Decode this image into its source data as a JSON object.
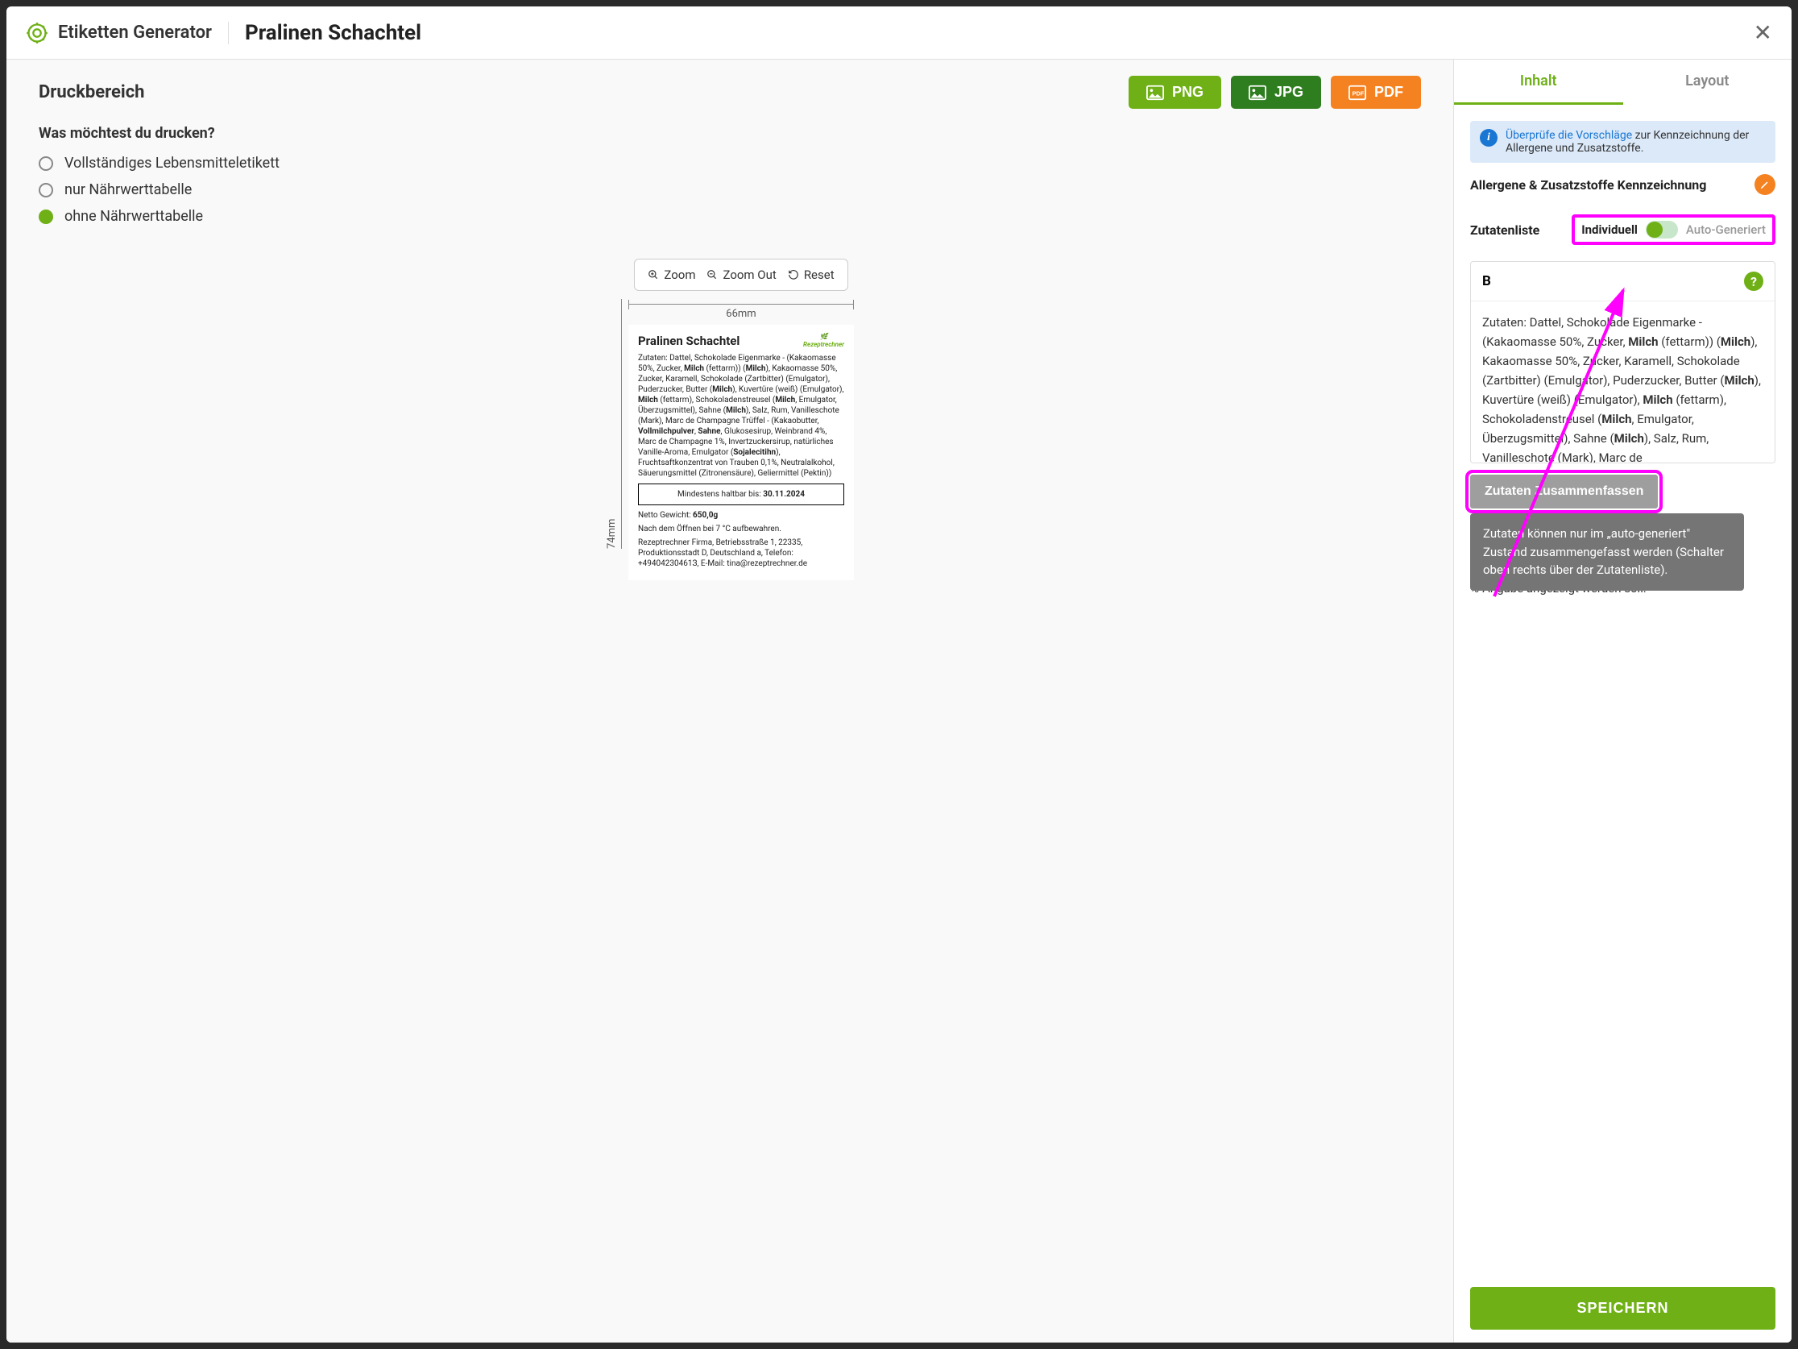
{
  "header": {
    "app_title": "Etiketten Generator",
    "recipe_title": "Pralinen Schachtel"
  },
  "left": {
    "heading": "Druckbereich",
    "export": {
      "png": "PNG",
      "jpg": "JPG",
      "pdf": "PDF"
    },
    "question": "Was möchtest du drucken?",
    "options": {
      "full": "Vollständiges Lebensmitteletikett",
      "only_nutri": "nur Nährwerttabelle",
      "no_nutri": "ohne Nährwerttabelle"
    },
    "zoom": {
      "in": "Zoom",
      "out": "Zoom Out",
      "reset": "Reset"
    },
    "ruler": {
      "width": "66mm",
      "height": "74mm"
    },
    "label": {
      "title": "Pralinen Schachtel",
      "brand": "Rezeptrechner",
      "ingredients_html": "Zutaten: Dattel, Schokolade Eigenmarke - (Kakaomasse 50%, Zucker, <b>Milch</b> (fettarm)) (<b>Milch</b>), Kakaomasse 50%, Zucker, Karamell, Schokolade (Zartbitter) (Emulgator), Puderzucker, Butter (<b>Milch</b>), Kuvertüre (weiß) (Emulgator), <b>Milch</b> (fettarm), Schokoladenstreusel (<b>Milch</b>, Emulgator, Überzugsmittel), Sahne (<b>Milch</b>), Salz, Rum, Vanilleschote (Mark), Marc de Champagne Trüffel - (Kakaobutter, <b>Vollmilchpulver</b>, <b>Sahne</b>, Glukosesirup, Weinbrand 4%, Marc de Champagne 1%, Invertzuckersirup, natürliches Vanille-Aroma, Emulgator (<b>Sojalecitihn</b>), Fruchtsaftkonzentrat von Trauben 0,1%, Neutralalkohol, Säuerungsmittel (Zitronensäure), Geliermittel (Pektin))",
      "mhd_label": "Mindestens haltbar bis: ",
      "mhd_date": "30.11.2024",
      "weight_label": "Netto Gewicht: ",
      "weight_value": "650,0g",
      "storage": "Nach dem Öffnen bei 7 °C aufbewahren.",
      "company": "Rezeptrechner Firma, Betriebsstraße 1, 22335, Produktionsstadt D, Deutschland a, Telefon: +49404230461З, E-Mail: tina@rezeptrechner.de"
    }
  },
  "right": {
    "tabs": {
      "content": "Inhalt",
      "layout": "Layout"
    },
    "info": {
      "link": "Überprüfe die Vorschläge",
      "text": " zur Kennzeichnung der Allergene und Zusatzstoffe."
    },
    "allergen_heading": "Allergene & Zusatzstoffe Kennzeichnung",
    "list_label": "Zutatenliste",
    "toggle": {
      "individual": "Individuell",
      "auto": "Auto-Generiert"
    },
    "ing_box": {
      "marker": "B",
      "text_html": "Zutaten: Dattel, Schokolade Eigenmarke - (Kakaomasse 50%, Zucker, <b>Milch</b> (fettarm)) (<b>Milch</b>), Kakaomasse 50%, Zucker, Karamell, Schokolade (Zartbitter) (Emulgator), Puderzucker, Butter (<b>Milch</b>), Kuvertüre (weiß) (Emulgator), <b>Milch</b> (fettarm), Schokoladenstreusel (<b>Milch</b>, Emulgator, Überzugsmittel), Sahne (<b>Milch</b>), Salz, Rum, Vanilleschote (Mark), Marc de"
    },
    "summarize": "Zutaten Zusammenfassen",
    "tooltip": "Zutaten können nur im „auto-generiert\" Zustand zusammengefasst werden (Schalter oben rechts über der Zutatenliste).",
    "percent_note": "%-Angabe angezeigt werden soll:",
    "save": "SPEICHERN"
  }
}
